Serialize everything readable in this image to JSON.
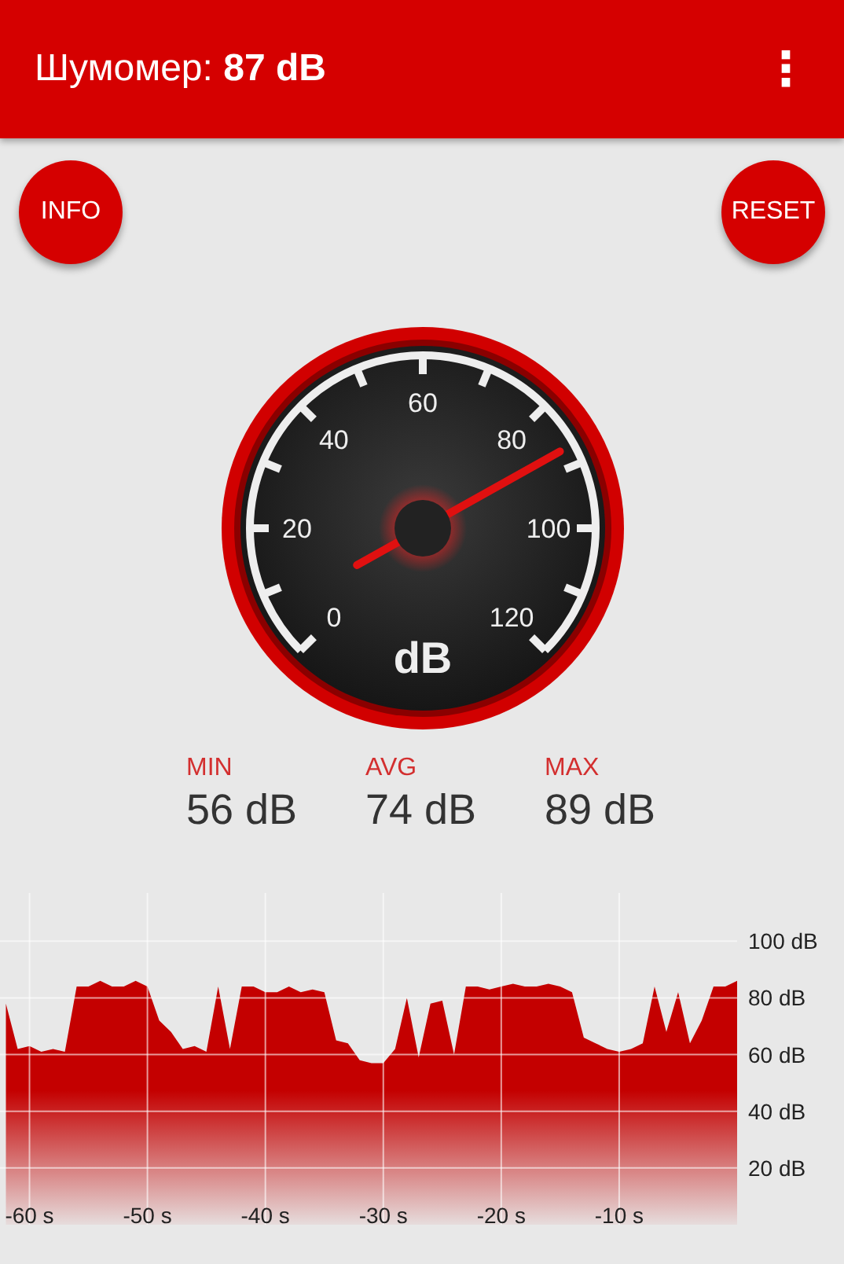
{
  "app_bar": {
    "title": "Шумомер: **87 dB**",
    "menu_icon": "⋮"
  },
  "buttons": [
    {
      "label": "INFO"
    },
    {
      "label": "RESET"
    }
  ],
  "gauge": {
    "unit": "dB",
    "scale_labels": [
      "0",
      "20",
      "40",
      "60",
      "80",
      "100",
      "120"
    ]
  },
  "stats": [
    {
      "label": "MIN",
      "value": "56 dB"
    },
    {
      "label": "AVG",
      "value": "74 dB"
    },
    {
      "label": "MAX",
      "value": "89 dB"
    }
  ],
  "history": {
    "chart_data": {
      "type": "area",
      "grid": true,
      "xlim": [
        -62.5,
        0
      ],
      "ylim": [
        0,
        117
      ],
      "xticks": [
        {
          "value": -60,
          "label": "-60 s"
        },
        {
          "value": -50,
          "label": "-50 s"
        },
        {
          "value": -40,
          "label": "-40 s"
        },
        {
          "value": -30,
          "label": "-30 s"
        },
        {
          "value": -20,
          "label": "-20 s"
        },
        {
          "value": -10,
          "label": "-10 s"
        }
      ],
      "yticks": [
        {
          "value": 20,
          "label": "20 dB"
        },
        {
          "value": 40,
          "label": "40 dB"
        },
        {
          "value": 60,
          "label": "60 dB"
        },
        {
          "value": 80,
          "label": "80 dB"
        },
        {
          "value": 100,
          "label": "100 dB"
        }
      ],
      "x": [
        -62,
        -61,
        -60,
        -59,
        -58,
        -57,
        -56,
        -55,
        -54,
        -53,
        -52,
        -51,
        -50,
        -49,
        -48,
        -47,
        -46,
        -45,
        -44,
        -43,
        -42,
        -41,
        -40,
        -39,
        -38,
        -37,
        -36,
        -35,
        -34,
        -33,
        -32,
        -31,
        -30,
        -29,
        -28,
        -27,
        -26,
        -25,
        -24,
        -23,
        -22,
        -21,
        -20,
        -19,
        -18,
        -17,
        -16,
        -15,
        -14,
        -13,
        -12,
        -11,
        -10,
        -9,
        -8,
        -7,
        -6,
        -5,
        -4,
        -3,
        -2,
        -1,
        0
      ],
      "series": [
        {
          "color": "#c40000",
          "values": [
            78,
            62,
            63,
            61,
            62,
            61,
            84,
            84,
            86,
            84,
            84,
            86,
            84,
            72,
            68,
            62,
            63,
            61,
            84,
            62,
            84,
            84,
            82,
            82,
            84,
            82,
            83,
            82,
            65,
            64,
            58,
            57,
            57,
            62,
            80,
            59,
            78,
            79,
            60,
            84,
            84,
            83,
            84,
            85,
            84,
            84,
            85,
            84,
            82,
            66,
            64,
            62,
            61,
            62,
            64,
            84,
            68,
            82,
            64,
            72,
            84,
            84,
            86
          ]
        }
      ]
    }
  }
}
